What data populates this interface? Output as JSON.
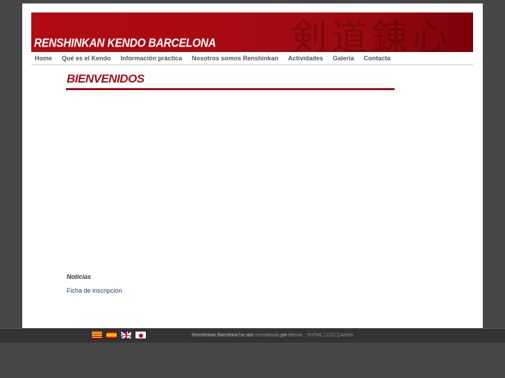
{
  "banner": {
    "title": "RENSHINKAN KENDO BARCELONA",
    "glyphs": "剣道錬心"
  },
  "nav": {
    "items": [
      {
        "label": "Home"
      },
      {
        "label": "Qué es el Kendo"
      },
      {
        "label": "Información práctica"
      },
      {
        "label": "Nosotros somos Renshinkan"
      },
      {
        "label": "Actividades"
      },
      {
        "label": "Galería"
      },
      {
        "label": "Contacta"
      }
    ]
  },
  "main": {
    "heading": "BIENVENIDOS",
    "news_label": "Noticias",
    "form_link": "Ficha de inscripción"
  },
  "footer": {
    "languages": [
      {
        "name": "flag-catalan-icon"
      },
      {
        "name": "flag-spain-icon"
      },
      {
        "name": "flag-uk-icon"
      },
      {
        "name": "flag-japan-icon"
      }
    ],
    "credits_text": "Renshinkan Barcelona ha sido",
    "credits_link": "rencodeado",
    "credits_by": "por",
    "credits_author": "Bernat",
    "credits_sep1": "::",
    "credits_xhtml": "XHTML",
    "credits_sep2": "|",
    "credits_css": "CSS",
    "credits_sep3": "||",
    "credits_admin": "Admin"
  },
  "colors": {
    "accent": "#a10f19",
    "background": "#464646",
    "footer": "#333333",
    "link": "#1a3c6e"
  }
}
